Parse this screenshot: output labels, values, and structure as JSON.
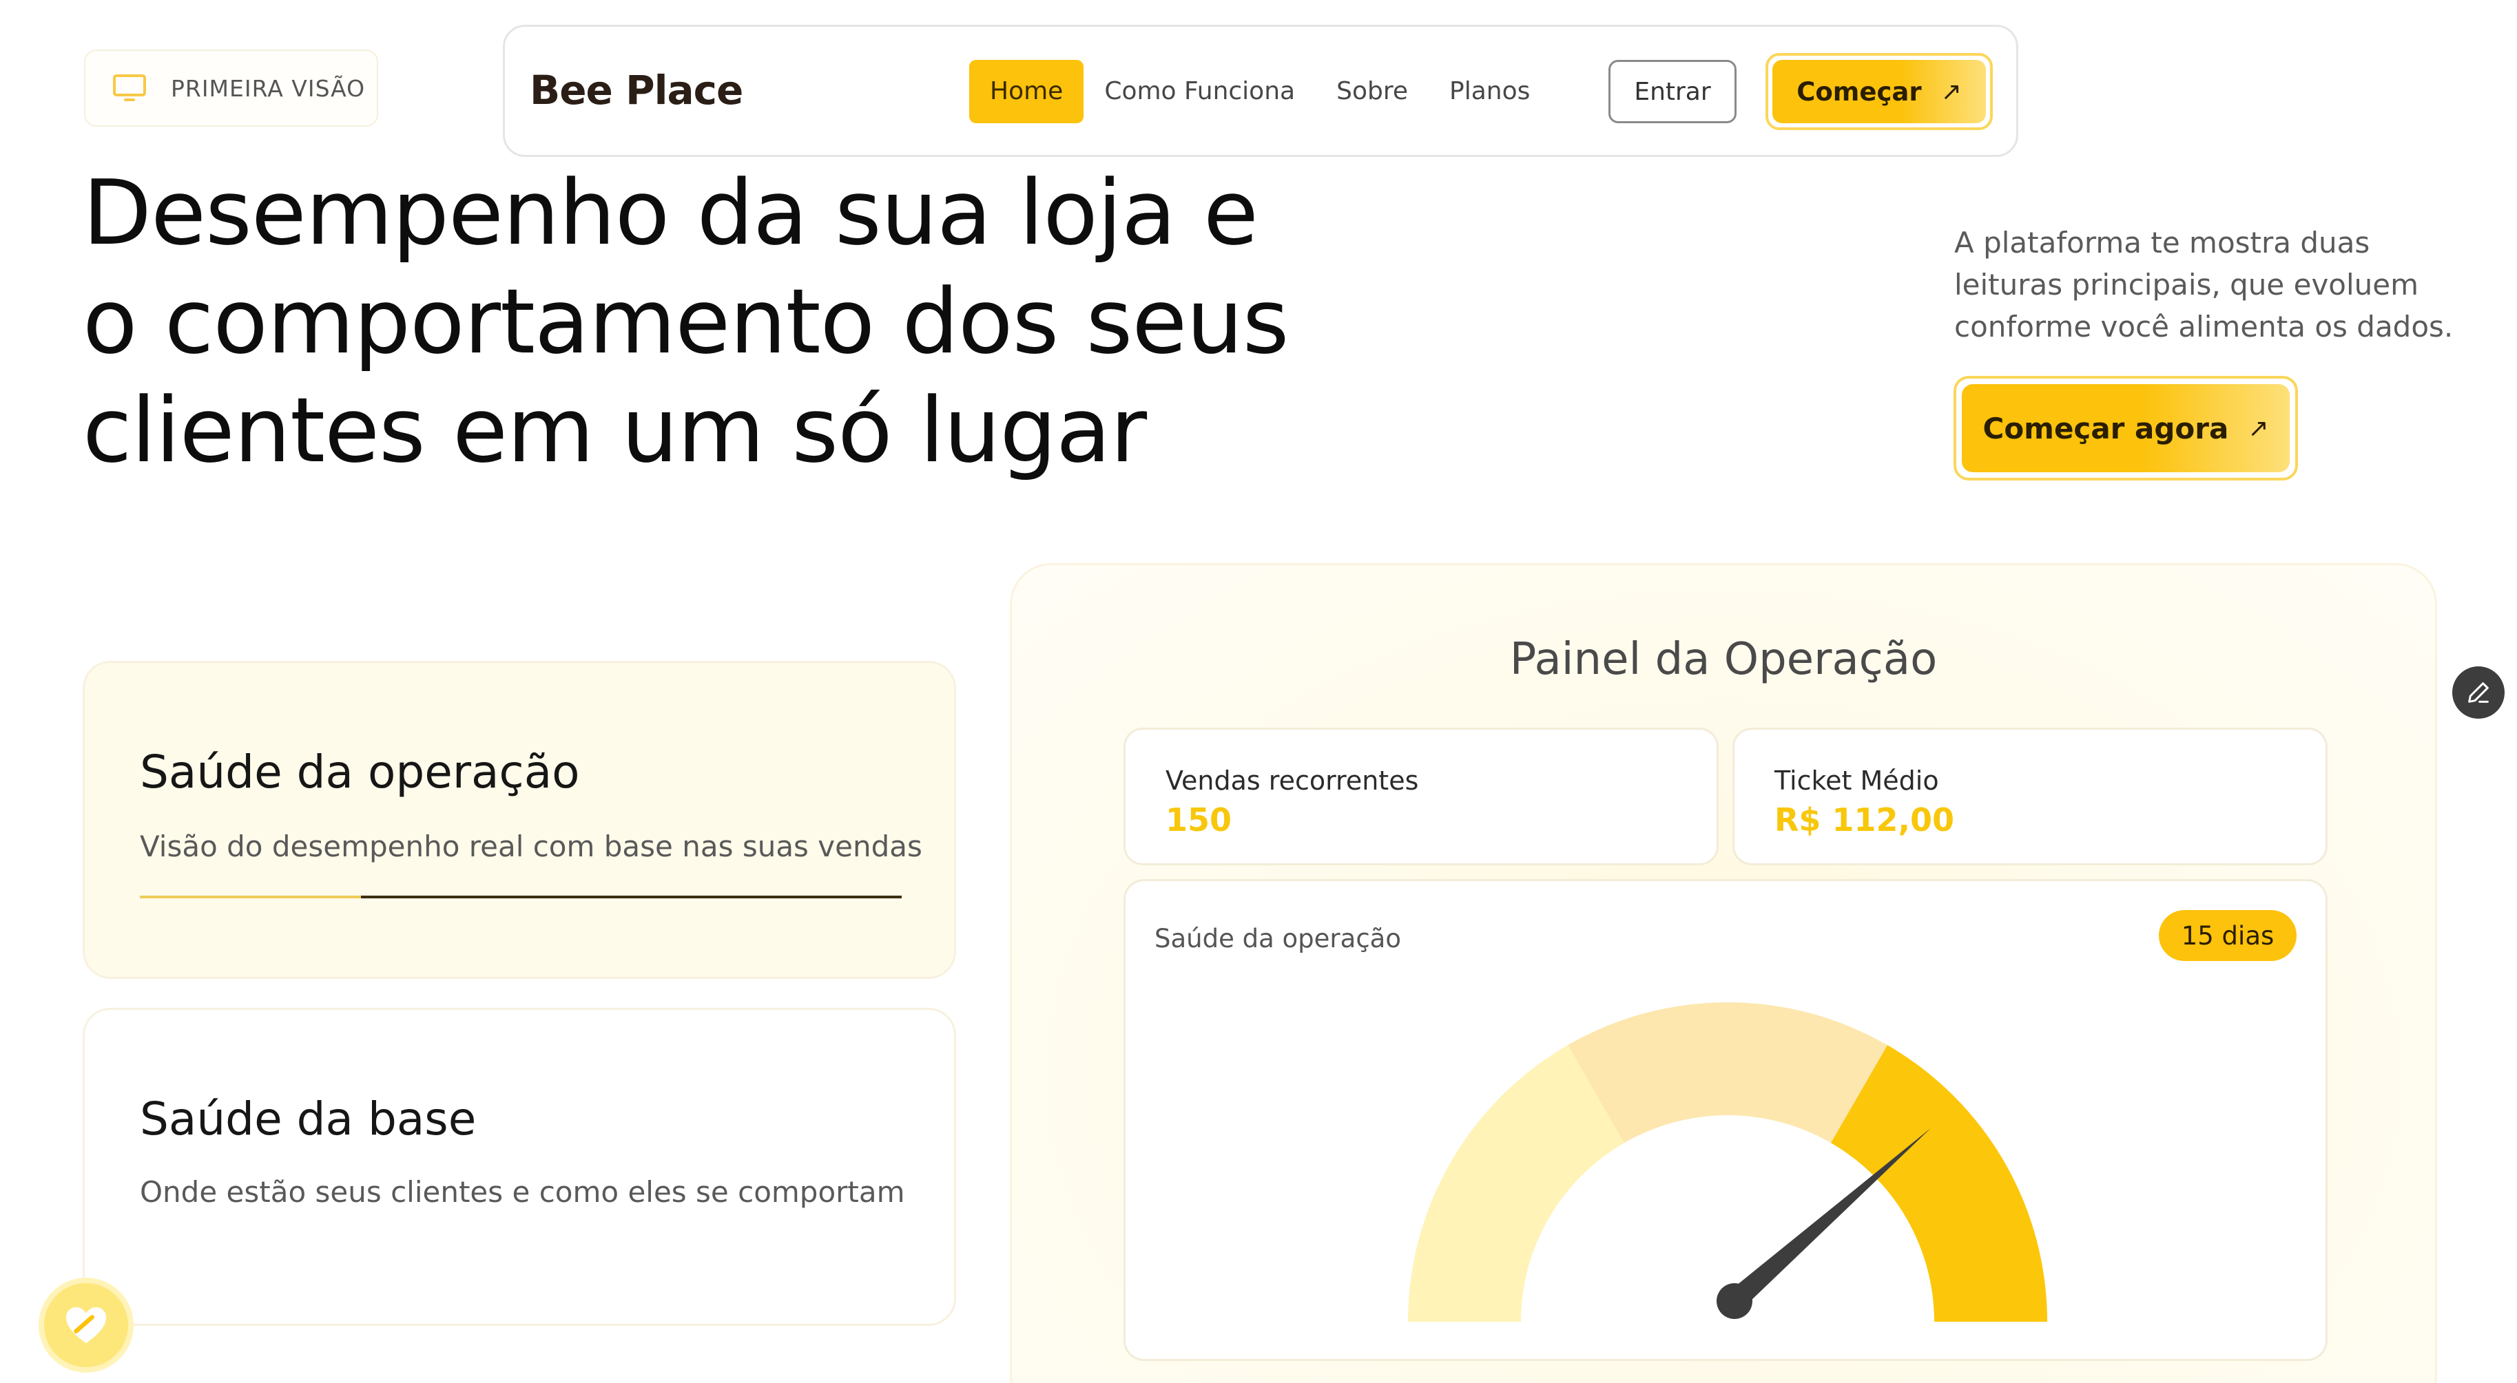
{
  "badge": {
    "label": "PRIMEIRA VISÃO",
    "icon": "monitor-icon"
  },
  "nav": {
    "logo": "Bee Place",
    "links": [
      {
        "label": "Home",
        "active": true
      },
      {
        "label": "Como Funciona",
        "active": false
      },
      {
        "label": "Sobre",
        "active": false
      },
      {
        "label": "Planos",
        "active": false
      }
    ],
    "login_label": "Entrar",
    "cta_label": "Começar",
    "cta_icon": "arrow-up-right-icon"
  },
  "hero": {
    "title_line1": "Desempenho da sua loja e",
    "title_line2": "o comportamento dos seus",
    "title_line3": "clientes em um só lugar",
    "description": "A plataforma te mostra duas leituras principais, que evoluem conforme você alimenta os dados.",
    "cta_label": "Começar agora",
    "cta_icon": "arrow-up-right-icon"
  },
  "cards": [
    {
      "title": "Saúde da operação",
      "subtitle": "Visão do desempenho real com base nas suas vendas",
      "progress": 0.29,
      "active": true
    },
    {
      "title": "Saúde da base",
      "subtitle": "Onde estão seus clientes e como eles se comportam",
      "active": false
    }
  ],
  "dashboard": {
    "title": "Painel da Operação",
    "stats": [
      {
        "label": "Vendas recorrentes",
        "value": "150"
      },
      {
        "label": "Ticket Médio",
        "value": "R$ 112,00"
      }
    ],
    "gauge": {
      "label": "Saúde da operação",
      "period": "15 dias",
      "value_fraction": 0.77,
      "segment_colors": [
        "#fff3b8",
        "#fde7ae",
        "#fcc60a"
      ],
      "needle_color": "#3d3d3d"
    }
  },
  "floating": {
    "edit_icon": "pencil-icon",
    "feedback_icon": "heart-icon"
  },
  "colors": {
    "accent": "#fcc20c",
    "value_text": "#f8c70c"
  }
}
